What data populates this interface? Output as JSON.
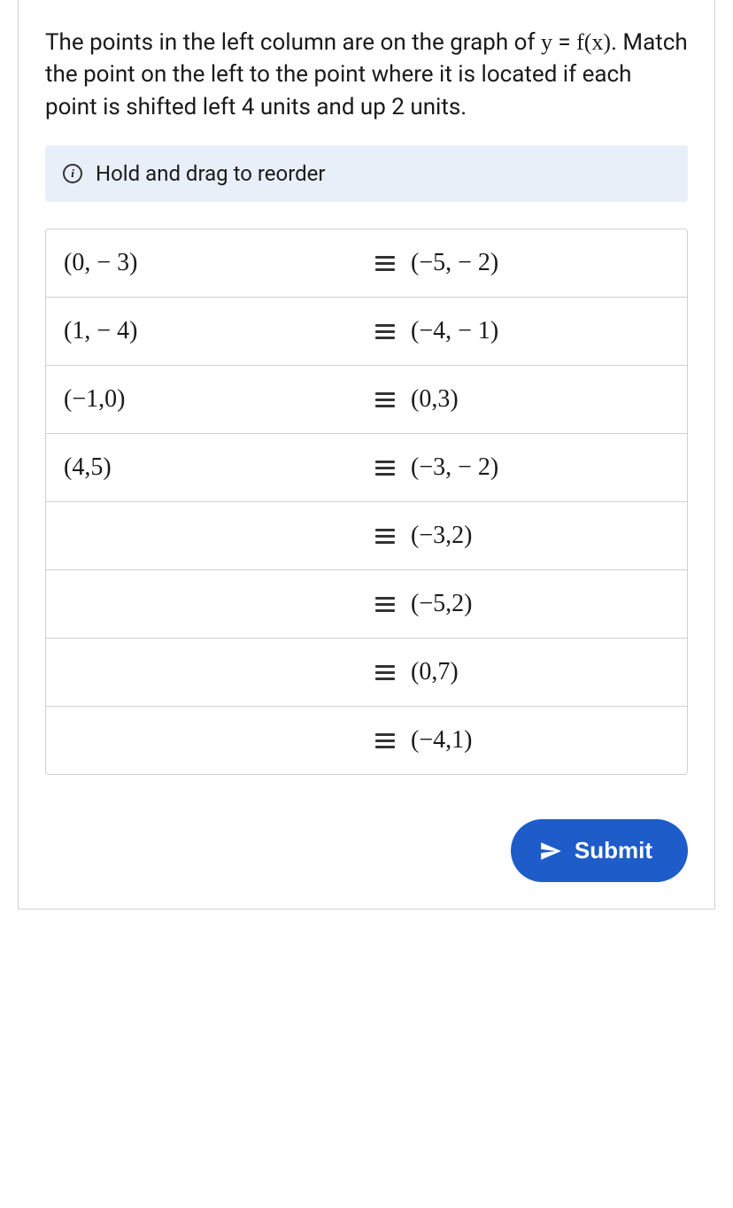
{
  "question": {
    "part1": "The points in the left column are on the graph of ",
    "math_y": "y",
    "math_eq": " = ",
    "math_fx": "f(x)",
    "part2": ". Match the point on the left to the point where it is located if each point is shifted left 4 units and up 2 units."
  },
  "info_text": "Hold and drag to reorder",
  "rows": [
    {
      "left": "(0, − 3)",
      "right": "(−5, − 2)"
    },
    {
      "left": "(1, − 4)",
      "right": "(−4, − 1)"
    },
    {
      "left": "(−1,0)",
      "right": "(0,3)"
    },
    {
      "left": "(4,5)",
      "right": "(−3, − 2)"
    },
    {
      "left": "",
      "right": "(−3,2)"
    },
    {
      "left": "",
      "right": "(−5,2)"
    },
    {
      "left": "",
      "right": "(0,7)"
    },
    {
      "left": "",
      "right": "(−4,1)"
    }
  ],
  "submit_label": "Submit"
}
